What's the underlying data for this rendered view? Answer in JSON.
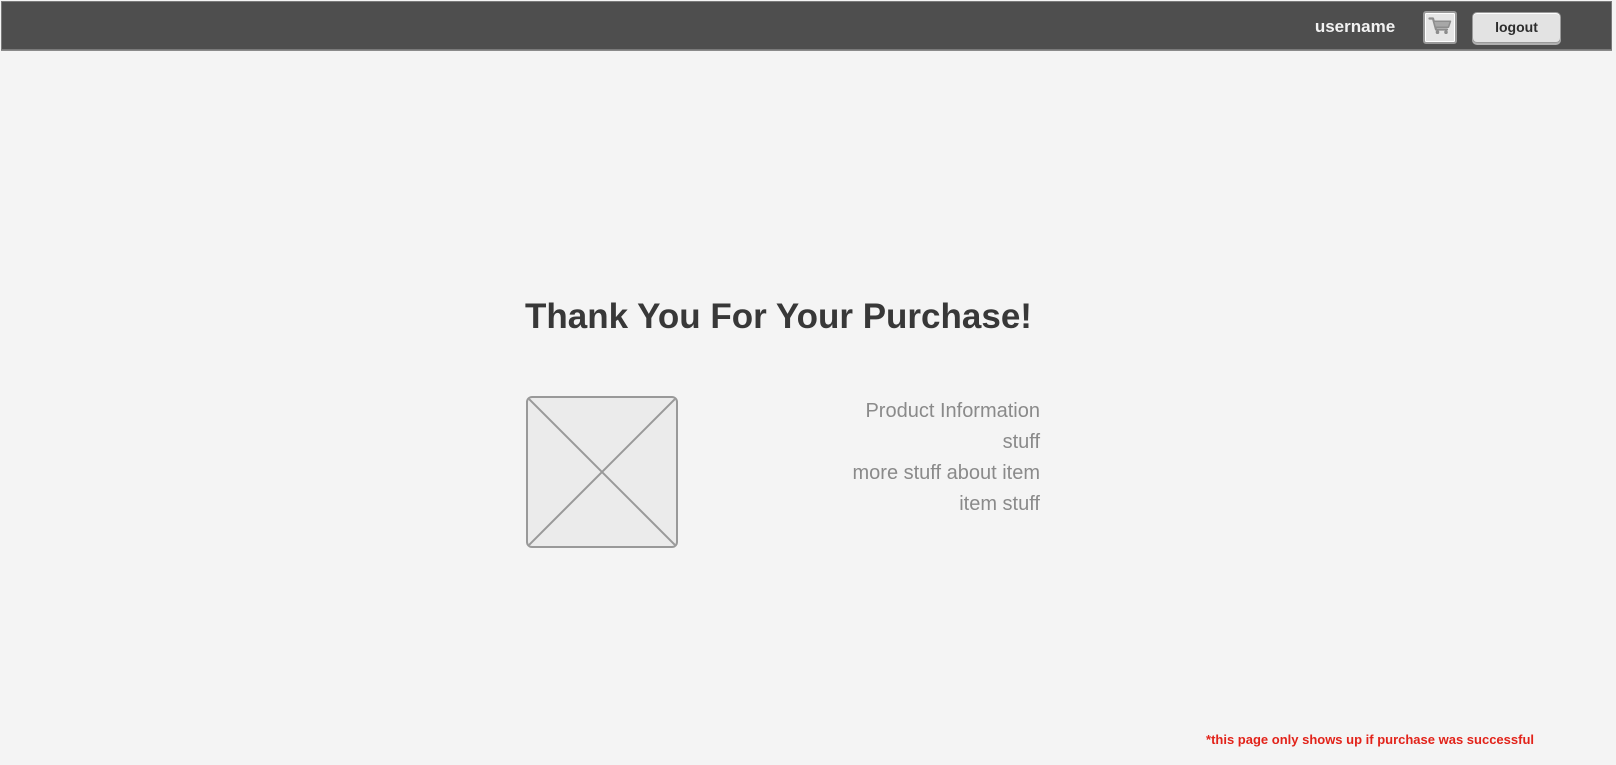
{
  "header": {
    "username": "username",
    "cart_icon": "cart-icon",
    "logout_label": "logout"
  },
  "main": {
    "title": "Thank You For Your Purchase!",
    "image_placeholder_icon": "image-placeholder-icon",
    "product_info": {
      "heading": "Product Information",
      "lines": [
        "stuff",
        "more stuff about item",
        "item stuff"
      ]
    }
  },
  "footnote": "*this page only shows up if purchase was successful",
  "colors": {
    "header_background": "#4e4e4e",
    "page_background": "#f4f4f4",
    "title_text": "#383838",
    "info_text": "#8a8a8a",
    "footnote_text": "#e2231a"
  }
}
